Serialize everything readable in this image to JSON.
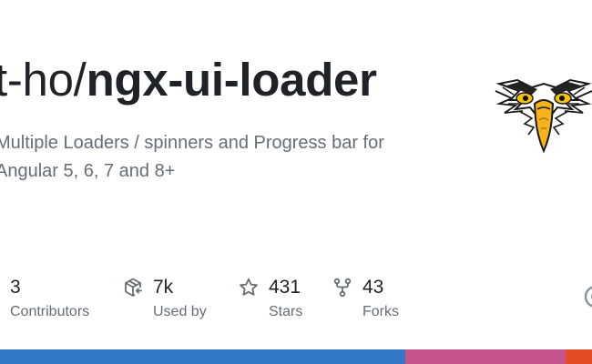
{
  "repo": {
    "owner": "t-ho/",
    "name": "ngx-ui-loader",
    "description_line1": "Multiple Loaders / spinners and Progress bar for",
    "description_line2": "Angular 5, 6, 7 and 8+"
  },
  "stats": {
    "contributors": {
      "value": "3",
      "label": "Contributors",
      "icon": "people-icon"
    },
    "used_by": {
      "value": "7k",
      "label": "Used by",
      "icon": "package-dependents-icon"
    },
    "stars": {
      "value": "431",
      "label": "Stars",
      "icon": "star-icon"
    },
    "forks": {
      "value": "43",
      "label": "Forks",
      "icon": "repo-forked-icon"
    }
  },
  "avatar": {
    "icon": "eagle-avatar-icon"
  },
  "languages": [
    {
      "color": "#3178c6",
      "share": 0.685
    },
    {
      "color": "#c6538c",
      "share": 0.27
    },
    {
      "color": "#e34c26",
      "share": 0.045
    }
  ],
  "colors": {
    "title": "#1f2328",
    "muted": "#656d76"
  }
}
